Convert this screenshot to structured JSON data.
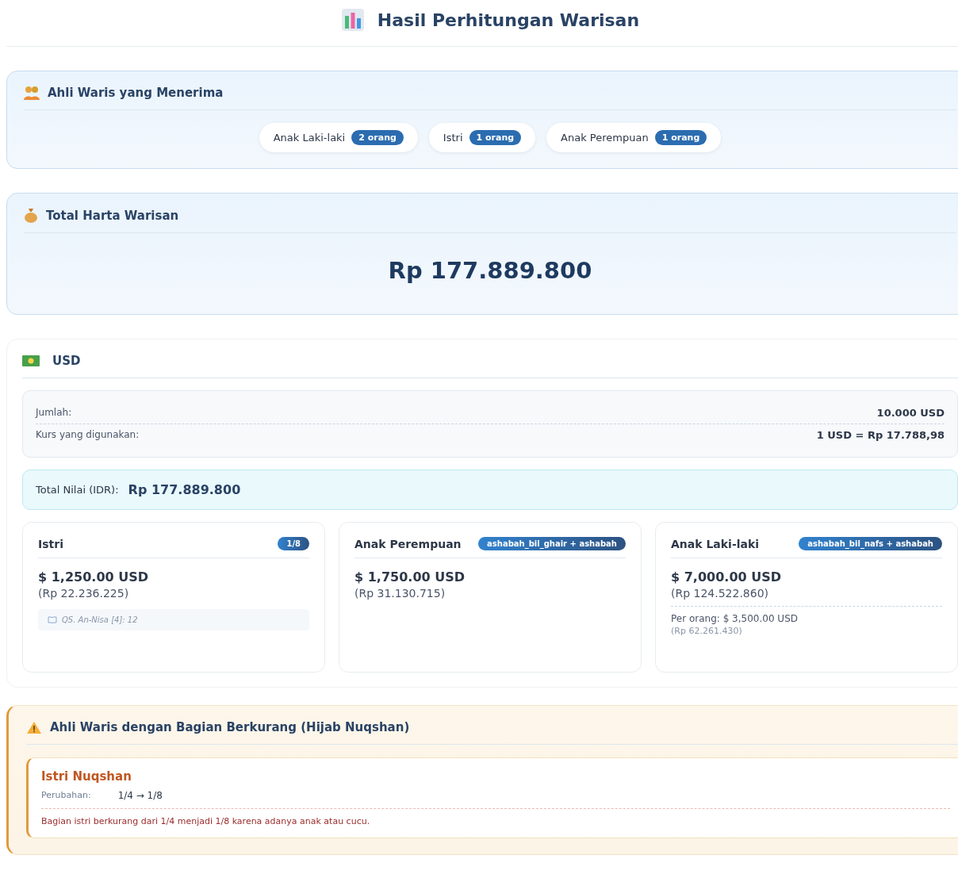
{
  "title": "Hasil Perhitungan Warisan",
  "heirs": {
    "heading": "Ahli Waris yang Menerima",
    "items": [
      {
        "name": "Anak Laki-laki",
        "count": "2 orang"
      },
      {
        "name": "Istri",
        "count": "1 orang"
      },
      {
        "name": "Anak Perempuan",
        "count": "1 orang"
      }
    ]
  },
  "total": {
    "heading": "Total Harta Warisan",
    "amount": "Rp 177.889.800"
  },
  "currency": {
    "heading": "USD",
    "rows": [
      {
        "label": "Jumlah:",
        "value": "10.000 USD"
      },
      {
        "label": "Kurs yang digunakan:",
        "value": "1 USD = Rp 17.788,98"
      }
    ],
    "total_label": "Total Nilai (IDR):",
    "total_value": "Rp 177.889.800",
    "shares": [
      {
        "name": "Istri",
        "badge": "1/8",
        "amount": "$ 1,250.00 USD",
        "idr": "(Rp 22.236.225)",
        "reference": "QS. An-Nisa [4]: 12"
      },
      {
        "name": "Anak Perempuan",
        "badge": "ashabah_bil_ghair + ashabah",
        "amount": "$ 1,750.00 USD",
        "idr": "(Rp 31.130.715)"
      },
      {
        "name": "Anak Laki-laki",
        "badge": "ashabah_bil_nafs + ashabah",
        "amount": "$ 7,000.00 USD",
        "idr": "(Rp 124.522.860)",
        "per_person": "Per orang: $ 3,500.00 USD",
        "per_person_idr": "(Rp 62.261.430)"
      }
    ]
  },
  "reduced": {
    "heading": "Ahli Waris dengan Bagian Berkurang (Hijab Nuqshan)",
    "items": [
      {
        "title": "Istri Nuqshan",
        "change_label": "Perubahan:",
        "change": "1/4 → 1/8",
        "note": "Bagian istri berkurang dari 1/4 menjadi 1/8 karena adanya anak atau cucu."
      }
    ]
  }
}
